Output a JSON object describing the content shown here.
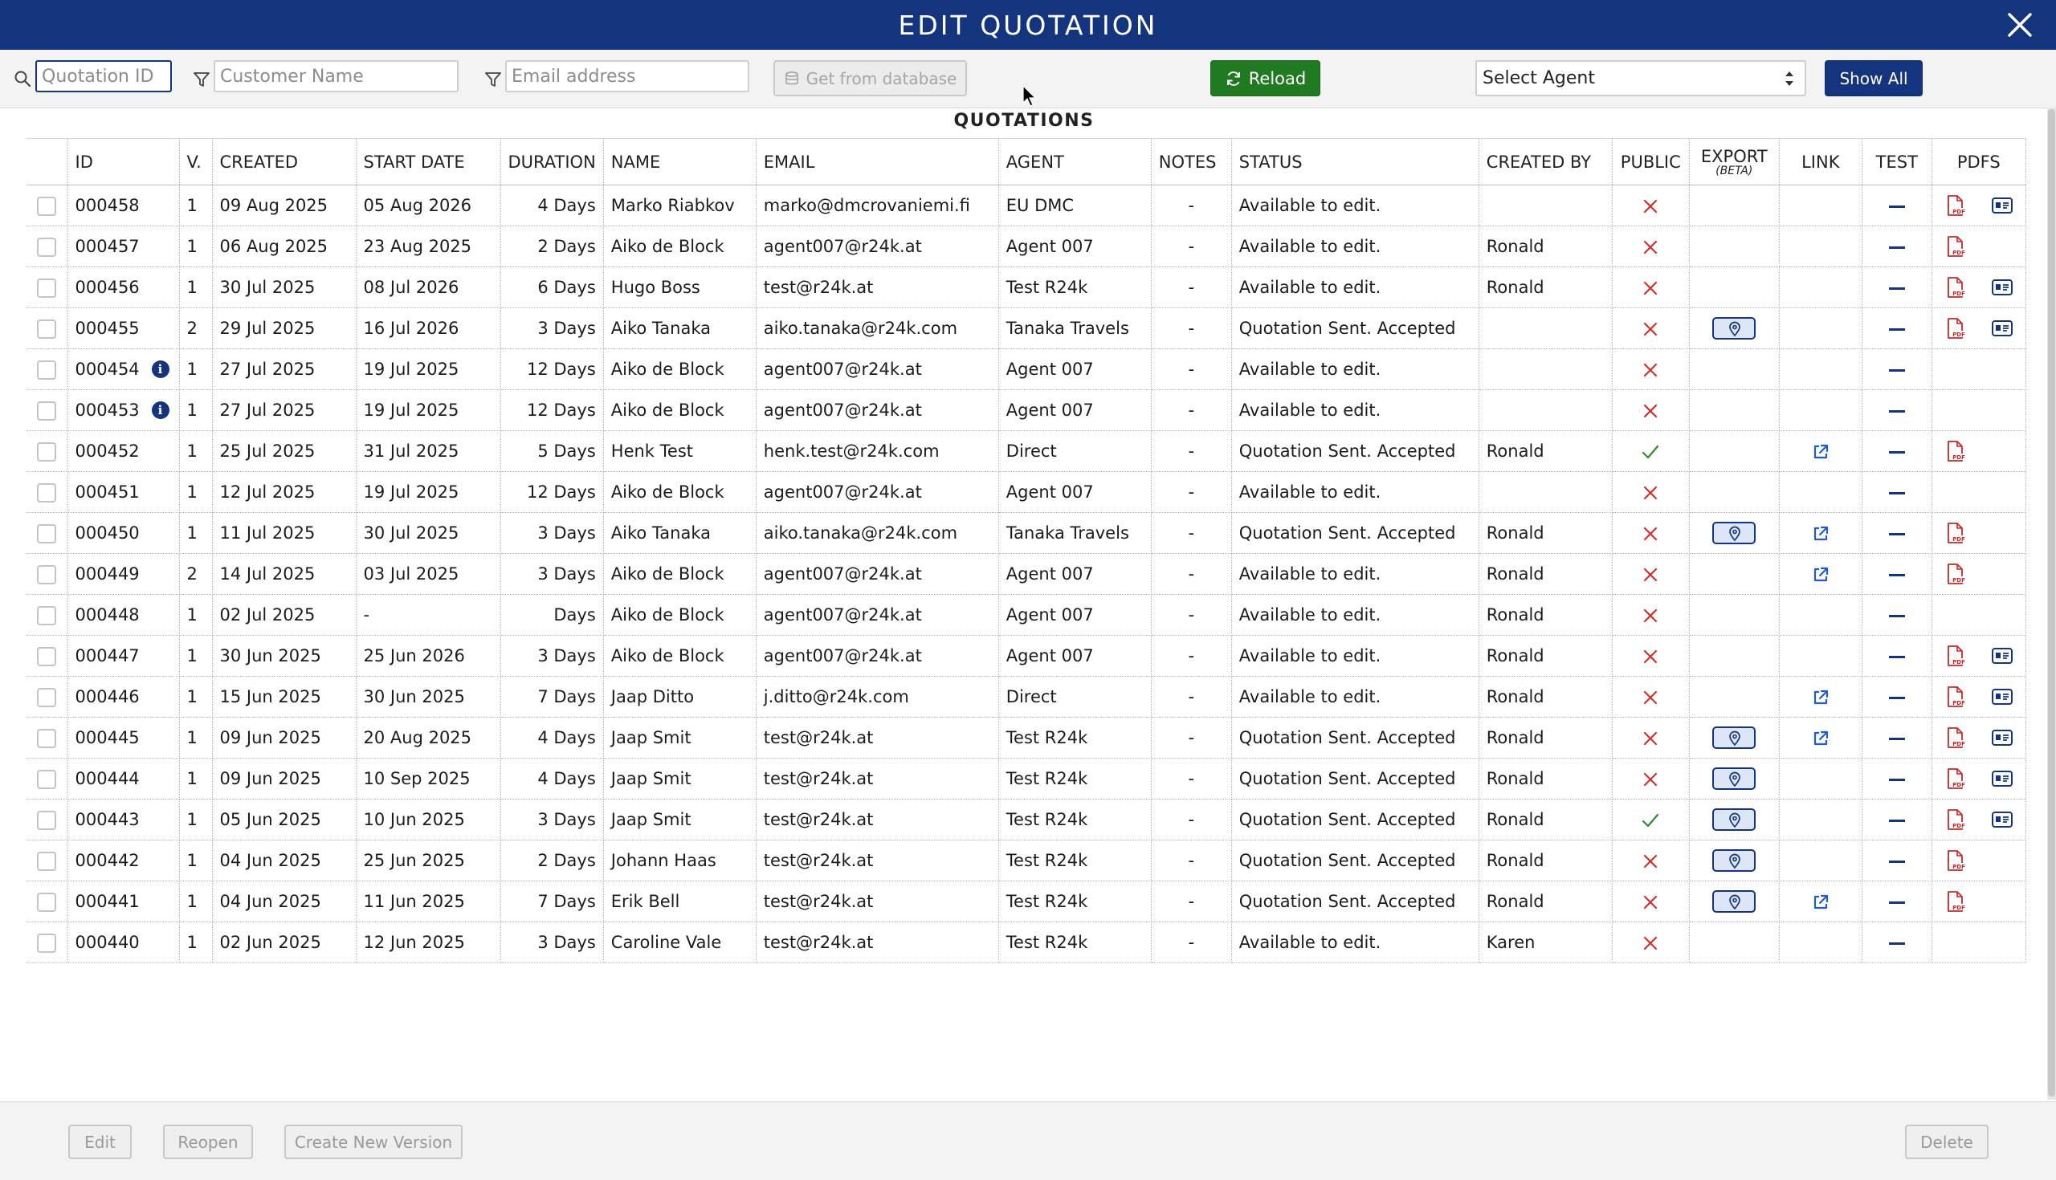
{
  "window": {
    "title": "EDIT QUOTATION",
    "close_icon": "close-icon"
  },
  "toolbar": {
    "quotation_id_placeholder": "Quotation ID",
    "customer_name_placeholder": "Customer Name",
    "email_placeholder": "Email address",
    "get_from_db_label": "Get from database",
    "reload_label": "Reload",
    "select_agent_value": "Select Agent",
    "show_all_label": "Show All"
  },
  "section_title": "QUOTATIONS",
  "columns": {
    "id": "ID",
    "version": "V.",
    "created": "CREATED",
    "start_date": "START DATE",
    "duration": "DURATION",
    "name": "NAME",
    "email": "EMAIL",
    "agent": "AGENT",
    "notes": "NOTES",
    "status": "STATUS",
    "created_by": "CREATED BY",
    "public": "PUBLIC",
    "export": "EXPORT",
    "export_sub": "(BETA)",
    "link": "LINK",
    "test": "TEST",
    "pdfs": "PDFS"
  },
  "rows": [
    {
      "id": "000458",
      "info": false,
      "v": "1",
      "created": "09 Aug 2025",
      "start": "05 Aug 2026",
      "duration": "4 Days",
      "name": "Marko Riabkov",
      "email": "marko@dmcrovaniemi.fi",
      "agent": "EU DMC",
      "notes": "-",
      "status": "Available to edit.",
      "created_by": "",
      "public": false,
      "export": false,
      "link": false,
      "pdf": true,
      "card": true
    },
    {
      "id": "000457",
      "info": false,
      "v": "1",
      "created": "06 Aug 2025",
      "start": "23 Aug 2025",
      "duration": "2 Days",
      "name": "Aiko de Block",
      "email": "agent007@r24k.at",
      "agent": "Agent 007",
      "notes": "-",
      "status": "Available to edit.",
      "created_by": "Ronald",
      "public": false,
      "export": false,
      "link": false,
      "pdf": true,
      "card": false
    },
    {
      "id": "000456",
      "info": false,
      "v": "1",
      "created": "30 Jul 2025",
      "start": "08 Jul 2026",
      "duration": "6 Days",
      "name": "Hugo Boss",
      "email": "test@r24k.at",
      "agent": "Test R24k",
      "notes": "-",
      "status": "Available to edit.",
      "created_by": "Ronald",
      "public": false,
      "export": false,
      "link": false,
      "pdf": true,
      "card": true
    },
    {
      "id": "000455",
      "info": false,
      "v": "2",
      "created": "29 Jul 2025",
      "start": "16 Jul 2026",
      "duration": "3 Days",
      "name": "Aiko Tanaka",
      "email": "aiko.tanaka@r24k.com",
      "agent": "Tanaka Travels",
      "notes": "-",
      "status": "Quotation Sent. Accepted",
      "created_by": "",
      "public": false,
      "export": true,
      "link": false,
      "pdf": true,
      "card": true
    },
    {
      "id": "000454",
      "info": true,
      "v": "1",
      "created": "27 Jul 2025",
      "start": "19 Jul 2025",
      "duration": "12 Days",
      "name": "Aiko de Block",
      "email": "agent007@r24k.at",
      "agent": "Agent 007",
      "notes": "-",
      "status": "Available to edit.",
      "created_by": "",
      "public": false,
      "export": false,
      "link": false,
      "pdf": false,
      "card": false
    },
    {
      "id": "000453",
      "info": true,
      "v": "1",
      "created": "27 Jul 2025",
      "start": "19 Jul 2025",
      "duration": "12 Days",
      "name": "Aiko de Block",
      "email": "agent007@r24k.at",
      "agent": "Agent 007",
      "notes": "-",
      "status": "Available to edit.",
      "created_by": "",
      "public": false,
      "export": false,
      "link": false,
      "pdf": false,
      "card": false
    },
    {
      "id": "000452",
      "info": false,
      "v": "1",
      "created": "25 Jul 2025",
      "start": "31 Jul 2025",
      "duration": "5 Days",
      "name": "Henk Test",
      "email": "henk.test@r24k.com",
      "agent": "Direct",
      "notes": "-",
      "status": "Quotation Sent. Accepted",
      "created_by": "Ronald",
      "public": true,
      "export": false,
      "link": true,
      "pdf": true,
      "card": false
    },
    {
      "id": "000451",
      "info": false,
      "v": "1",
      "created": "12 Jul 2025",
      "start": "19 Jul 2025",
      "duration": "12 Days",
      "name": "Aiko de Block",
      "email": "agent007@r24k.at",
      "agent": "Agent 007",
      "notes": "-",
      "status": "Available to edit.",
      "created_by": "",
      "public": false,
      "export": false,
      "link": false,
      "pdf": false,
      "card": false
    },
    {
      "id": "000450",
      "info": false,
      "v": "1",
      "created": "11 Jul 2025",
      "start": "30 Jul 2025",
      "duration": "3 Days",
      "name": "Aiko Tanaka",
      "email": "aiko.tanaka@r24k.com",
      "agent": "Tanaka Travels",
      "notes": "-",
      "status": "Quotation Sent. Accepted",
      "created_by": "Ronald",
      "public": false,
      "export": true,
      "link": true,
      "pdf": true,
      "card": false
    },
    {
      "id": "000449",
      "info": false,
      "v": "2",
      "created": "14 Jul 2025",
      "start": "03 Jul 2025",
      "duration": "3 Days",
      "name": "Aiko de Block",
      "email": "agent007@r24k.at",
      "agent": "Agent 007",
      "notes": "-",
      "status": "Available to edit.",
      "created_by": "Ronald",
      "public": false,
      "export": false,
      "link": true,
      "pdf": true,
      "card": false
    },
    {
      "id": "000448",
      "info": false,
      "v": "1",
      "created": "02 Jul 2025",
      "start": "-",
      "duration": "Days",
      "name": "Aiko de Block",
      "email": "agent007@r24k.at",
      "agent": "Agent 007",
      "notes": "-",
      "status": "Available to edit.",
      "created_by": "Ronald",
      "public": false,
      "export": false,
      "link": false,
      "pdf": false,
      "card": false
    },
    {
      "id": "000447",
      "info": false,
      "v": "1",
      "created": "30 Jun 2025",
      "start": "25 Jun 2026",
      "duration": "3 Days",
      "name": "Aiko de Block",
      "email": "agent007@r24k.at",
      "agent": "Agent 007",
      "notes": "-",
      "status": "Available to edit.",
      "created_by": "Ronald",
      "public": false,
      "export": false,
      "link": false,
      "pdf": true,
      "card": true
    },
    {
      "id": "000446",
      "info": false,
      "v": "1",
      "created": "15 Jun 2025",
      "start": "30 Jun 2025",
      "duration": "7 Days",
      "name": "Jaap Ditto",
      "email": "j.ditto@r24k.com",
      "agent": "Direct",
      "notes": "-",
      "status": "Available to edit.",
      "created_by": "Ronald",
      "public": false,
      "export": false,
      "link": true,
      "pdf": true,
      "card": true
    },
    {
      "id": "000445",
      "info": false,
      "v": "1",
      "created": "09 Jun 2025",
      "start": "20 Aug 2025",
      "duration": "4 Days",
      "name": "Jaap Smit",
      "email": "test@r24k.at",
      "agent": "Test R24k",
      "notes": "-",
      "status": "Quotation Sent. Accepted",
      "created_by": "Ronald",
      "public": false,
      "export": true,
      "link": true,
      "pdf": true,
      "card": true
    },
    {
      "id": "000444",
      "info": false,
      "v": "1",
      "created": "09 Jun 2025",
      "start": "10 Sep 2025",
      "duration": "4 Days",
      "name": "Jaap Smit",
      "email": "test@r24k.at",
      "agent": "Test R24k",
      "notes": "-",
      "status": "Quotation Sent. Accepted",
      "created_by": "Ronald",
      "public": false,
      "export": true,
      "link": false,
      "pdf": true,
      "card": true
    },
    {
      "id": "000443",
      "info": false,
      "v": "1",
      "created": "05 Jun 2025",
      "start": "10 Jun 2025",
      "duration": "3 Days",
      "name": "Jaap Smit",
      "email": "test@r24k.at",
      "agent": "Test R24k",
      "notes": "-",
      "status": "Quotation Sent. Accepted",
      "created_by": "Ronald",
      "public": true,
      "export": true,
      "link": false,
      "pdf": true,
      "card": true
    },
    {
      "id": "000442",
      "info": false,
      "v": "1",
      "created": "04 Jun 2025",
      "start": "25 Jun 2025",
      "duration": "2 Days",
      "name": "Johann Haas",
      "email": "test@r24k.at",
      "agent": "Test R24k",
      "notes": "-",
      "status": "Quotation Sent. Accepted",
      "created_by": "Ronald",
      "public": false,
      "export": true,
      "link": false,
      "pdf": true,
      "card": false
    },
    {
      "id": "000441",
      "info": false,
      "v": "1",
      "created": "04 Jun 2025",
      "start": "11 Jun 2025",
      "duration": "7 Days",
      "name": "Erik Bell",
      "email": "test@r24k.at",
      "agent": "Test R24k",
      "notes": "-",
      "status": "Quotation Sent. Accepted",
      "created_by": "Ronald",
      "public": false,
      "export": true,
      "link": true,
      "pdf": true,
      "card": false
    },
    {
      "id": "000440",
      "info": false,
      "v": "1",
      "created": "02 Jun 2025",
      "start": "12 Jun 2025",
      "duration": "3 Days",
      "name": "Caroline Vale",
      "email": "test@r24k.at",
      "agent": "Test R24k",
      "notes": "-",
      "status": "Available to edit.",
      "created_by": "Karen",
      "public": false,
      "export": false,
      "link": false,
      "pdf": false,
      "card": false
    }
  ],
  "footer": {
    "edit_label": "Edit",
    "reopen_label": "Reopen",
    "new_version_label": "Create New Version",
    "delete_label": "Delete"
  },
  "colors": {
    "brand": "#14347e",
    "reload": "#1f7a22",
    "cross": "#d0312d",
    "check": "#2f8a2f",
    "pdf": "#c62828"
  }
}
